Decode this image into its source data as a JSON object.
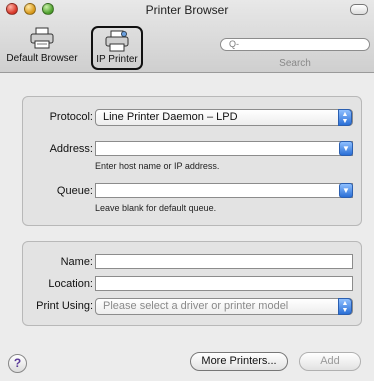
{
  "window": {
    "title": "Printer Browser"
  },
  "toolbar": {
    "items": [
      {
        "label": "Default Browser"
      },
      {
        "label": "IP Printer"
      }
    ],
    "search": {
      "placeholder": "Q-",
      "label": "Search"
    }
  },
  "form": {
    "protocol": {
      "label": "Protocol:",
      "value": "Line Printer Daemon – LPD"
    },
    "address": {
      "label": "Address:",
      "value": "",
      "hint": "Enter host name or IP address."
    },
    "queue": {
      "label": "Queue:",
      "value": "",
      "hint": "Leave blank for default queue."
    },
    "name": {
      "label": "Name:",
      "value": ""
    },
    "location": {
      "label": "Location:",
      "value": ""
    },
    "print_using": {
      "label": "Print Using:",
      "value": "Please select a driver or printer model"
    }
  },
  "footer": {
    "help": "?",
    "more_printers": "More Printers...",
    "add": "Add"
  }
}
